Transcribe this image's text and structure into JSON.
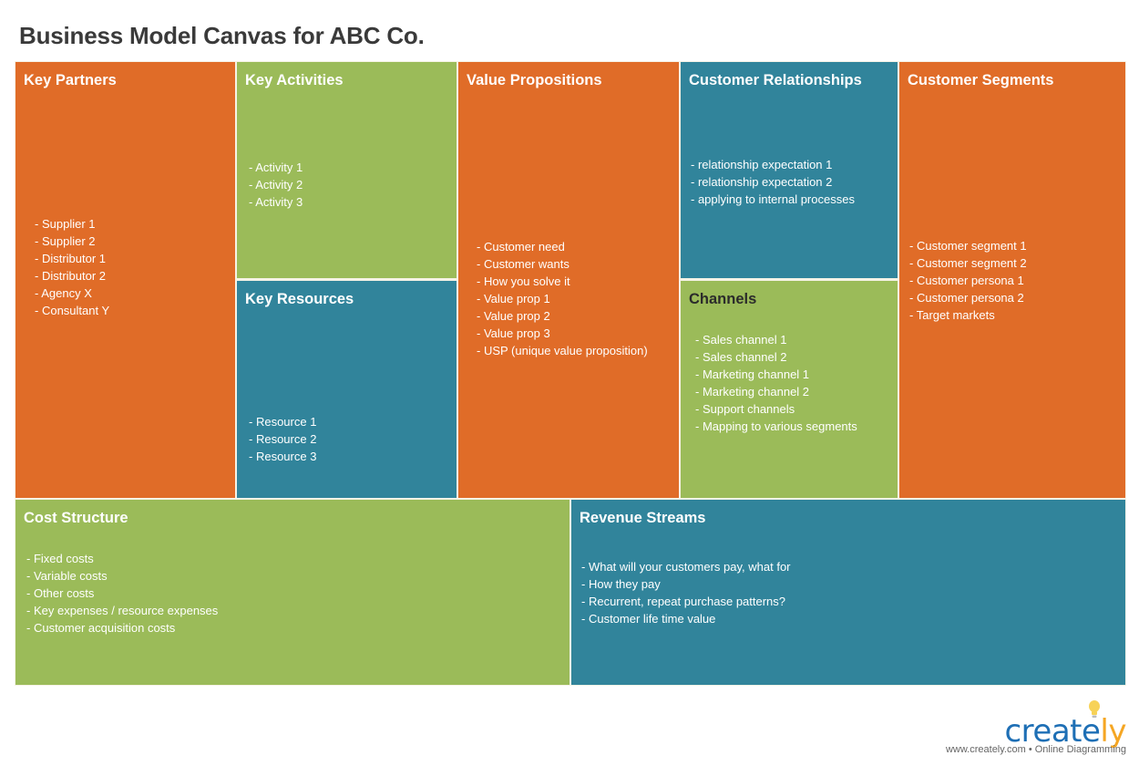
{
  "title": "Business Model Canvas for ABC Co.",
  "colors": {
    "orange": "#e06c28",
    "green": "#9bbb59",
    "teal": "#31849b"
  },
  "blocks": {
    "key_partners": {
      "heading": "Key Partners",
      "items": [
        "Supplier 1",
        "Supplier 2",
        "Distributor 1",
        "Distributor 2",
        "Agency X",
        "Consultant Y"
      ]
    },
    "key_activities": {
      "heading": "Key Activities",
      "items": [
        "Activity 1",
        "Activity 2",
        "Activity 3"
      ]
    },
    "key_resources": {
      "heading": "Key Resources",
      "items": [
        "Resource 1",
        "Resource 2",
        "Resource 3"
      ]
    },
    "value_propositions": {
      "heading": "Value Propositions",
      "items": [
        "Customer need",
        "Customer wants",
        "How you solve it",
        "Value prop 1",
        "Value prop 2",
        "Value prop 3",
        "USP (unique value proposition)"
      ]
    },
    "customer_relationships": {
      "heading": "Customer Relationships",
      "items": [
        "relationship expectation 1",
        "relationship expectation 2",
        "applying to internal processes"
      ]
    },
    "channels": {
      "heading": "Channels",
      "items": [
        "Sales channel 1",
        "Sales channel 2",
        "Marketing channel 1",
        "Marketing channel 2",
        "Support channels",
        "Mapping to various segments"
      ]
    },
    "customer_segments": {
      "heading": "Customer Segments",
      "items": [
        "Customer segment 1",
        "Customer segment 2",
        "Customer persona 1",
        "Customer persona 2",
        "Target markets"
      ]
    },
    "cost_structure": {
      "heading": "Cost Structure",
      "items": [
        "Fixed costs",
        "Variable costs",
        "Other costs",
        "Key expenses / resource expenses",
        "Customer acquisition costs"
      ]
    },
    "revenue_streams": {
      "heading": "Revenue Streams",
      "items": [
        "What will your customers pay, what for",
        "How they pay",
        "Recurrent, repeat purchase patterns?",
        "Customer life time value"
      ]
    }
  },
  "branding": {
    "logo_main": "create",
    "logo_accent": "ly",
    "tagline": "www.creately.com • Online Diagramming",
    "icon": "lightbulb-icon"
  }
}
